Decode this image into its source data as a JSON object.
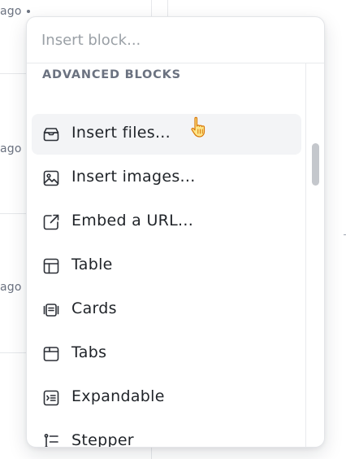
{
  "background": {
    "rows": [
      {
        "meta": "ago"
      },
      {
        "meta": "ago"
      },
      {
        "meta": "ago"
      }
    ]
  },
  "popover": {
    "search": {
      "placeholder": "Insert block..."
    },
    "section_title": "ADVANCED BLOCKS",
    "items": [
      {
        "label": "Insert files...",
        "icon": "inbox-icon",
        "highlighted": true
      },
      {
        "label": "Insert images...",
        "icon": "image-icon",
        "highlighted": false
      },
      {
        "label": "Embed a URL...",
        "icon": "external-link-icon",
        "highlighted": false
      },
      {
        "label": "Table",
        "icon": "table-icon",
        "highlighted": false
      },
      {
        "label": "Cards",
        "icon": "cards-icon",
        "highlighted": false
      },
      {
        "label": "Tabs",
        "icon": "folder-tab-icon",
        "highlighted": false
      },
      {
        "label": "Expandable",
        "icon": "expandable-list-icon",
        "highlighted": false
      },
      {
        "label": "Stepper",
        "icon": "stepper-icon",
        "highlighted": false
      }
    ]
  },
  "colors": {
    "text": "#1f2328",
    "muted": "#6b7280",
    "placeholder": "#9aa0a6",
    "hover_bg": "#f3f4f6",
    "scroll_thumb": "#c4c7cc",
    "cursor_fill": "#fde68a"
  }
}
